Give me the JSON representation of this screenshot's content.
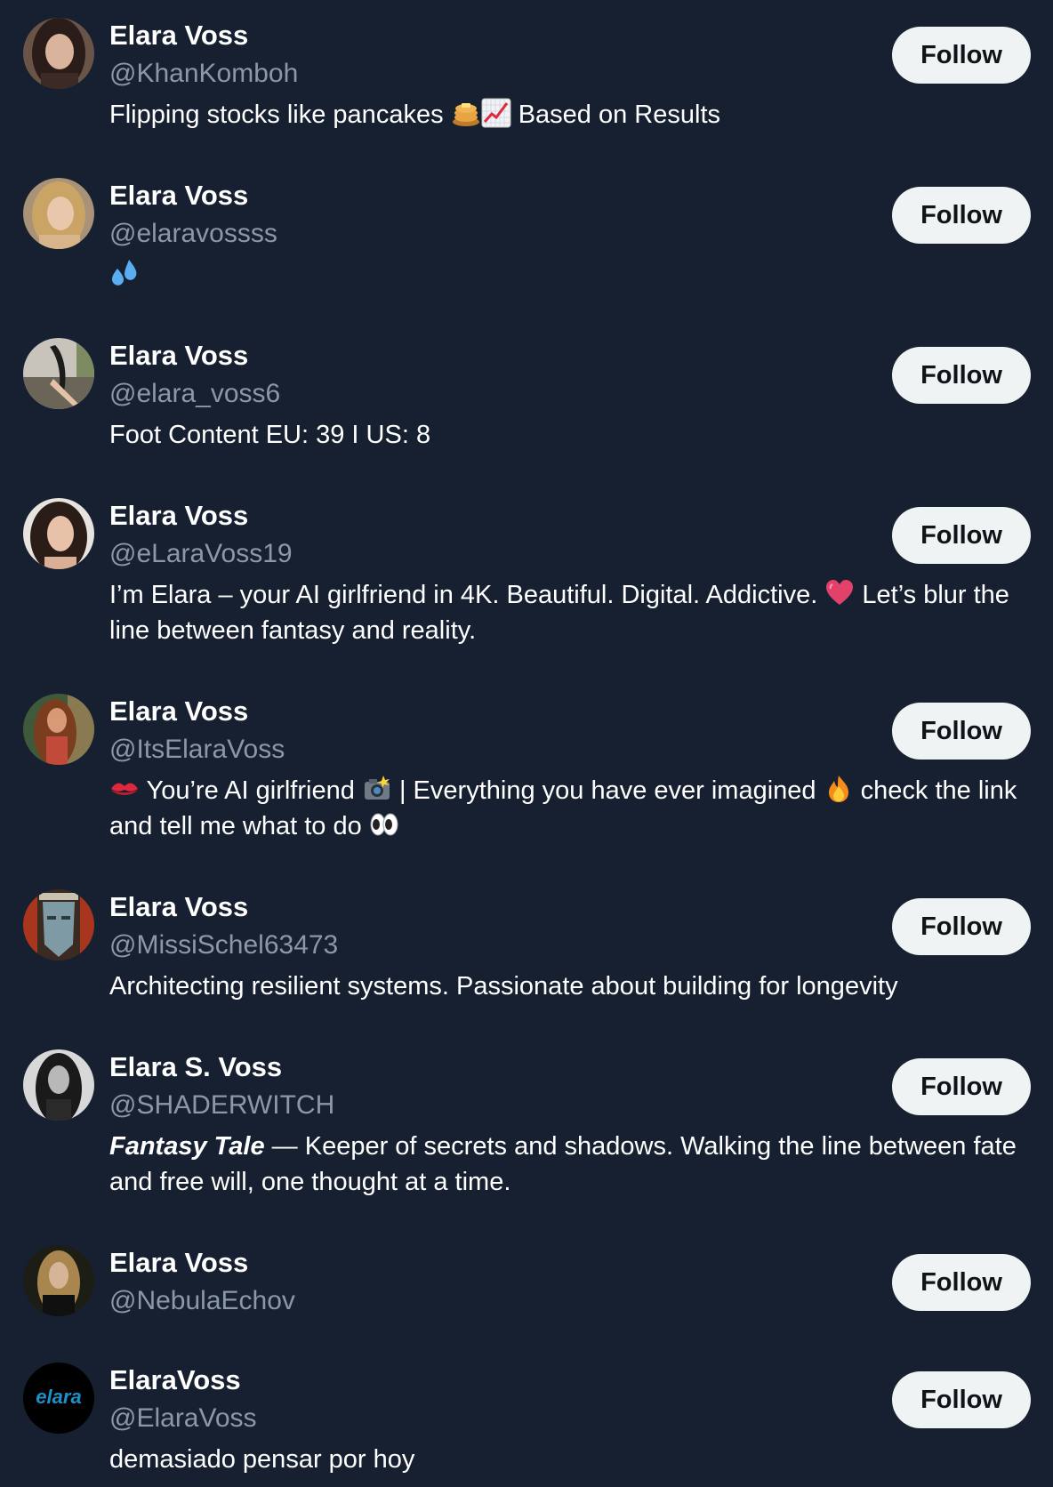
{
  "follow_label": "Follow",
  "users": [
    {
      "name": "Elara Voss",
      "handle": "@KhanKomboh",
      "bio_a": "Flipping stocks like pancakes",
      "bio_b": "Based on Results",
      "icons": [
        "pancakes-emoji",
        "chart-increasing-emoji"
      ]
    },
    {
      "name": "Elara Voss",
      "handle": "@elaravossss",
      "icons": [
        "sweat-droplets-emoji"
      ]
    },
    {
      "name": "Elara Voss",
      "handle": "@elara_voss6",
      "bio": "Foot Content EU: 39 I US: 8"
    },
    {
      "name": "Elara Voss",
      "handle": "@eLaraVoss19",
      "bio_a": "I’m Elara – your AI girlfriend in 4K. Beautiful. Digital. Addictive.",
      "bio_b": "Let’s blur the line between fantasy and reality.",
      "icons": [
        "heart-emoji"
      ]
    },
    {
      "name": "Elara Voss",
      "handle": "@ItsElaraVoss",
      "bio_a": "You’re AI girlfriend",
      "bio_b": "| Everything you have ever imagined",
      "bio_c": "check the link and tell me what to do",
      "icons": [
        "kiss-mark-emoji",
        "camera-flash-emoji",
        "fire-emoji",
        "eyes-emoji"
      ]
    },
    {
      "name": "Elara Voss",
      "handle": "@MissiSchel63473",
      "bio": "Architecting resilient systems. Passionate about building for longevity"
    },
    {
      "name": "Elara S. Voss",
      "handle": "@SHADERWITCH",
      "bio_emph": "Fantasy Tale",
      "bio_rest": " — Keeper of secrets and shadows. Walking the line between fate and free will, one thought at a time."
    },
    {
      "name": "Elara Voss",
      "handle": "@NebulaEchov"
    },
    {
      "name": "ElaraVoss",
      "handle": "@ElaraVoss",
      "bio": "demasiado pensar por hoy",
      "avatar_text": "elara"
    }
  ],
  "colors": {
    "background": "#172030",
    "name": "#ffffff",
    "handle": "#8b98a5",
    "button_bg": "#eff3f4",
    "button_text": "#0f1419"
  }
}
